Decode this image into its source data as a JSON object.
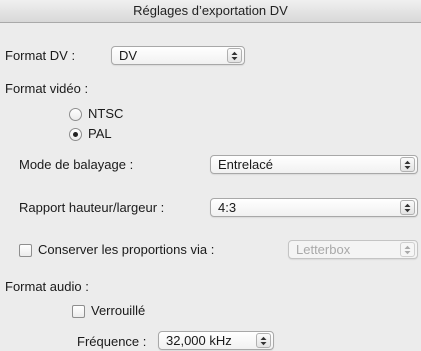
{
  "window": {
    "title": "Réglages d’exportation DV"
  },
  "format_dv": {
    "label": "Format DV :",
    "value": "DV"
  },
  "format_video": {
    "label": "Format vidéo :",
    "options": [
      {
        "label": "NTSC",
        "selected": false
      },
      {
        "label": "PAL",
        "selected": true
      }
    ]
  },
  "scan_mode": {
    "label": "Mode de balayage :",
    "value": "Entrelacé"
  },
  "aspect_ratio": {
    "label": "Rapport hauteur/largeur :",
    "value": "4:3"
  },
  "preserve_proportions": {
    "label": "Conserver les proportions via :",
    "checked": false,
    "value": "Letterbox",
    "enabled": false
  },
  "format_audio": {
    "label": "Format audio :",
    "locked": {
      "label": "Verrouillé",
      "checked": false
    },
    "frequency": {
      "label": "Fréquence :",
      "value": "32,000 kHz"
    }
  }
}
